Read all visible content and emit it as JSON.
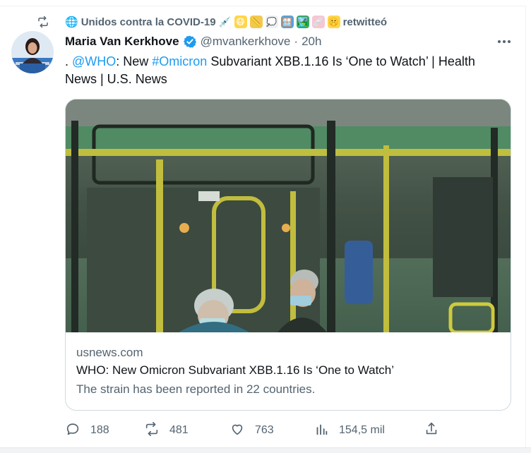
{
  "retweet": {
    "label": "🌐Unidos contra la COVID-19 💉😷📏💭🪟🏞️🩹🤫 retwitteó",
    "prefix": "🌐",
    "name": "Unidos contra la COVID-19",
    "suffix": "retwitteó"
  },
  "tweet": {
    "author_name": "Maria Van Kerkhove",
    "author_handle": "@mvankerkhove",
    "separator": "·",
    "time": "20h",
    "text_parts": {
      "lead": ". ",
      "mention": "@WHO",
      "after_mention": ": New ",
      "hashtag": "#Omicron",
      "rest": " Subvariant XBB.1.16 Is ‘One to Watch’ | Health News | U.S. News"
    }
  },
  "card": {
    "domain": "usnews.com",
    "title": "WHO: New Omicron Subvariant XBB.1.16 Is ‘One to Watch’",
    "description": "The strain has been reported in 22 countries."
  },
  "actions": {
    "replies": "188",
    "retweets": "481",
    "likes": "763",
    "views": "154,5 mil"
  },
  "icons": {
    "retweet": "retweet-icon",
    "verified": "verified-badge-icon",
    "more": "more-icon",
    "reply": "reply-icon",
    "like": "heart-icon",
    "views": "views-icon",
    "share": "share-icon"
  },
  "colors": {
    "accent": "#1d9bf0",
    "muted": "#536471",
    "text": "#0f1419",
    "border": "#cfd9de"
  }
}
